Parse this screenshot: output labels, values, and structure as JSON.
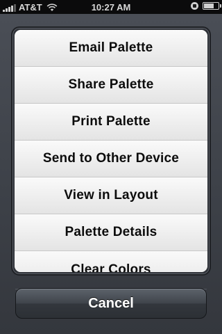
{
  "status_bar": {
    "carrier": "AT&T",
    "time": "10:27 AM"
  },
  "menu": {
    "items": [
      "Email Palette",
      "Share Palette",
      "Print Palette",
      "Send to Other Device",
      "View in Layout",
      "Palette Details",
      "Clear Colors"
    ]
  },
  "cancel": {
    "label": "Cancel"
  }
}
